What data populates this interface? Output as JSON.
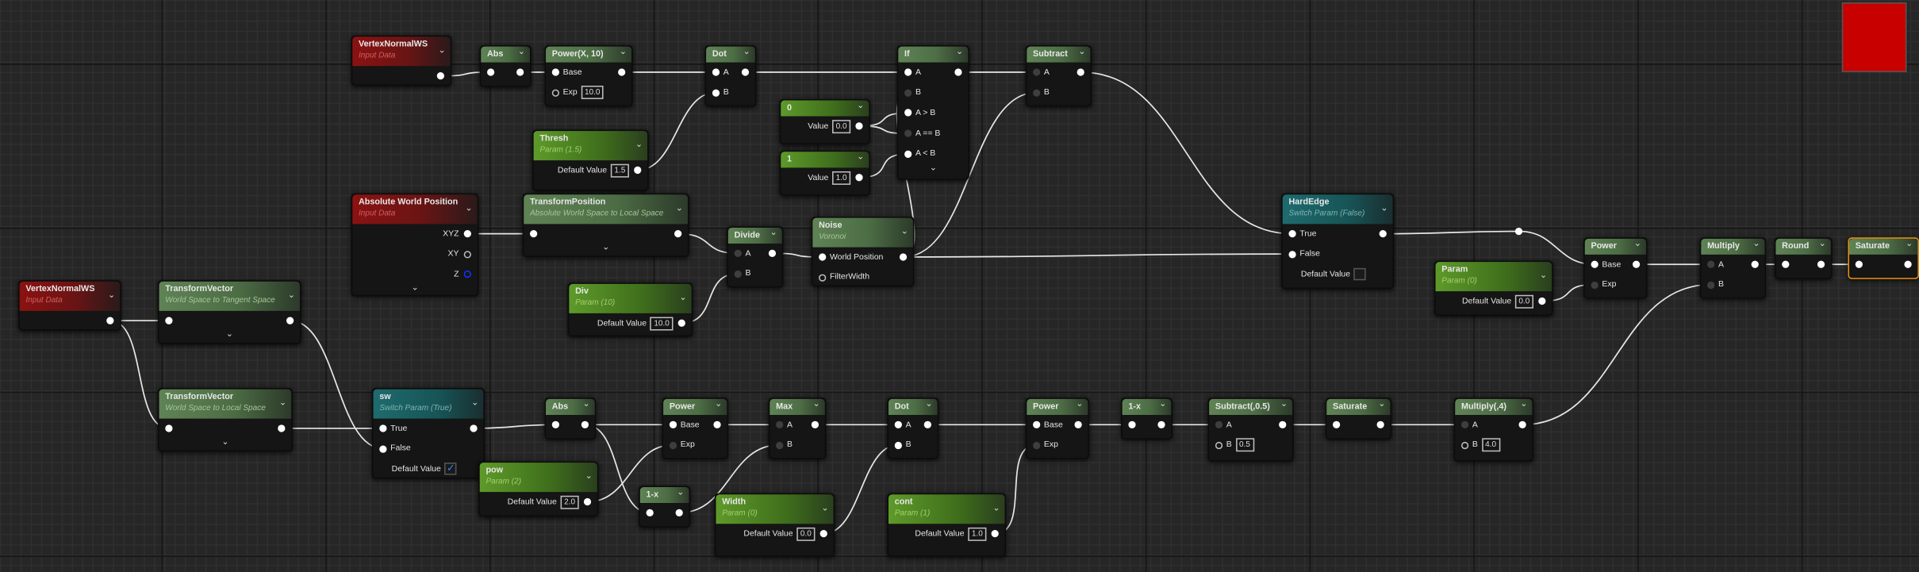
{
  "graph": {
    "nodes": [
      {
        "id": "vnws1",
        "kind": "input",
        "title": "VertexNormalWS",
        "subtitle": "Input Data",
        "rows": [
          {
            "out": "f"
          }
        ]
      },
      {
        "id": "abs1",
        "kind": "function",
        "title": "Abs",
        "rows": [
          {
            "in": "f",
            "out": "f"
          }
        ]
      },
      {
        "id": "pow10",
        "kind": "function",
        "title": "Power(X, 10)",
        "rows": [
          {
            "label": "Base",
            "in": "f",
            "out": "f"
          },
          {
            "label": "Exp",
            "value": "10.0",
            "in": "h"
          }
        ]
      },
      {
        "id": "dot1",
        "kind": "function",
        "title": "Dot",
        "rows": [
          {
            "label": "A",
            "in": "f",
            "out": "f"
          },
          {
            "label": "B",
            "in": "f"
          }
        ]
      },
      {
        "id": "thresh",
        "kind": "param",
        "title": "Thresh",
        "subtitle": "Param (1.5)",
        "rows": [
          {
            "label": "Default Value",
            "value": "1.5",
            "out": "f"
          }
        ]
      },
      {
        "id": "c0",
        "kind": "param",
        "title": "0",
        "rows": [
          {
            "label": "Value",
            "value": "0.0",
            "out": "f"
          }
        ]
      },
      {
        "id": "c1",
        "kind": "param",
        "title": "1",
        "rows": [
          {
            "label": "Value",
            "value": "1.0",
            "out": "f"
          }
        ]
      },
      {
        "id": "if",
        "kind": "function",
        "title": "If",
        "expand": true,
        "rows": [
          {
            "label": "A",
            "in": "f",
            "out": "f"
          },
          {
            "label": "B",
            "in": "d"
          },
          {
            "label": "A > B",
            "in": "f"
          },
          {
            "label": "A == B",
            "in": "d"
          },
          {
            "label": "A < B",
            "in": "f"
          }
        ]
      },
      {
        "id": "subtract",
        "kind": "function",
        "title": "Subtract",
        "rows": [
          {
            "label": "A",
            "in": "d",
            "out": "f"
          },
          {
            "label": "B",
            "in": "d"
          }
        ]
      },
      {
        "id": "awp",
        "kind": "input",
        "title": "Absolute World Position",
        "subtitle": "Input Data",
        "expand": true,
        "rows": [
          {
            "label": "XYZ",
            "out": "f"
          },
          {
            "label": "XY",
            "out": "h"
          },
          {
            "label": "Z",
            "out": "blue"
          }
        ]
      },
      {
        "id": "tpos",
        "kind": "function",
        "title": "TransformPosition",
        "subtitle": "Absolute World Space to Local Space",
        "expand": true,
        "rows": [
          {
            "in": "f",
            "out": "f"
          }
        ]
      },
      {
        "id": "divide",
        "kind": "function",
        "title": "Divide",
        "rows": [
          {
            "label": "A",
            "in": "d",
            "out": "f"
          },
          {
            "label": "B",
            "in": "d"
          }
        ]
      },
      {
        "id": "div",
        "kind": "param",
        "title": "Div",
        "subtitle": "Param (10)",
        "rows": [
          {
            "label": "Default Value",
            "value": "10.0",
            "out": "f"
          }
        ]
      },
      {
        "id": "noise",
        "kind": "function",
        "title": "Noise",
        "subtitle": "Voronoi",
        "rows": [
          {
            "label": "World Position",
            "in": "f",
            "out": "f"
          },
          {
            "label": "FilterWidth",
            "in": "h"
          }
        ]
      },
      {
        "id": "hardedge",
        "kind": "switch",
        "title": "HardEdge",
        "subtitle": "Switch Param (False)",
        "rows": [
          {
            "label": "True",
            "in": "f",
            "out": "f"
          },
          {
            "label": "False",
            "in": "f"
          },
          {
            "label": "Default Value",
            "checked": false
          }
        ]
      },
      {
        "id": "param0",
        "kind": "param",
        "title": "Param",
        "subtitle": "Param (0)",
        "rows": [
          {
            "label": "Default Value",
            "value": "0.0",
            "out": "f"
          }
        ]
      },
      {
        "id": "power2",
        "kind": "function",
        "title": "Power",
        "rows": [
          {
            "label": "Base",
            "in": "f",
            "out": "f"
          },
          {
            "label": "Exp",
            "in": "d"
          }
        ]
      },
      {
        "id": "multiply",
        "kind": "function",
        "title": "Multiply",
        "rows": [
          {
            "label": "A",
            "in": "d",
            "out": "f"
          },
          {
            "label": "B",
            "in": "d"
          }
        ]
      },
      {
        "id": "round",
        "kind": "function",
        "title": "Round",
        "rows": [
          {
            "in": "f",
            "out": "f"
          }
        ]
      },
      {
        "id": "saturate",
        "kind": "function",
        "title": "Saturate",
        "selected": true,
        "rows": [
          {
            "in": "f",
            "out": "f"
          }
        ]
      },
      {
        "id": "vnws2",
        "kind": "input",
        "title": "VertexNormalWS",
        "subtitle": "Input Data",
        "rows": [
          {
            "out": "f"
          }
        ]
      },
      {
        "id": "tv1",
        "kind": "function",
        "title": "TransformVector",
        "subtitle": "World Space to Tangent Space",
        "expand": true,
        "rows": [
          {
            "in": "f",
            "out": "f"
          }
        ]
      },
      {
        "id": "tv2",
        "kind": "function",
        "title": "TransformVector",
        "subtitle": "World Space to Local Space",
        "expand": true,
        "rows": [
          {
            "in": "f",
            "out": "f"
          }
        ]
      },
      {
        "id": "sw",
        "kind": "switch",
        "title": "sw",
        "subtitle": "Switch Param (True)",
        "rows": [
          {
            "label": "True",
            "in": "f",
            "out": "f"
          },
          {
            "label": "False",
            "in": "f"
          },
          {
            "label": "Default Value",
            "checked": true
          }
        ]
      },
      {
        "id": "abs2",
        "kind": "function",
        "title": "Abs",
        "rows": [
          {
            "in": "f",
            "out": "f"
          }
        ]
      },
      {
        "id": "pow",
        "kind": "param",
        "title": "pow",
        "subtitle": "Param (2)",
        "rows": [
          {
            "label": "Default Value",
            "value": "2.0",
            "out": "f"
          }
        ]
      },
      {
        "id": "power3",
        "kind": "function",
        "title": "Power",
        "rows": [
          {
            "label": "Base",
            "in": "f",
            "out": "f"
          },
          {
            "label": "Exp",
            "in": "d"
          }
        ]
      },
      {
        "id": "onex1",
        "kind": "function",
        "title": "1-x",
        "rows": [
          {
            "in": "f",
            "out": "f"
          }
        ]
      },
      {
        "id": "max",
        "kind": "function",
        "title": "Max",
        "rows": [
          {
            "label": "A",
            "in": "d",
            "out": "f"
          },
          {
            "label": "B",
            "in": "d"
          }
        ]
      },
      {
        "id": "width",
        "kind": "param",
        "title": "Width",
        "subtitle": "Param (0)",
        "rows": [
          {
            "label": "Default Value",
            "value": "0.0",
            "out": "f"
          }
        ]
      },
      {
        "id": "dot2",
        "kind": "function",
        "title": "Dot",
        "rows": [
          {
            "label": "A",
            "in": "f",
            "out": "f"
          },
          {
            "label": "B",
            "in": "f"
          }
        ]
      },
      {
        "id": "cont",
        "kind": "param",
        "title": "cont",
        "subtitle": "Param (1)",
        "rows": [
          {
            "label": "Default Value",
            "value": "1.0",
            "out": "f"
          }
        ]
      },
      {
        "id": "power4",
        "kind": "function",
        "title": "Power",
        "rows": [
          {
            "label": "Base",
            "in": "f",
            "out": "f"
          },
          {
            "label": "Exp",
            "in": "d"
          }
        ]
      },
      {
        "id": "onex2",
        "kind": "function",
        "title": "1-x",
        "rows": [
          {
            "in": "f",
            "out": "f"
          }
        ]
      },
      {
        "id": "sub05",
        "kind": "function",
        "title": "Subtract(,0.5)",
        "rows": [
          {
            "label": "A",
            "in": "d",
            "out": "f"
          },
          {
            "label": "B",
            "value": "0.5",
            "in": "h"
          }
        ]
      },
      {
        "id": "sat2",
        "kind": "function",
        "title": "Saturate",
        "rows": [
          {
            "in": "f",
            "out": "f"
          }
        ]
      },
      {
        "id": "mul4",
        "kind": "function",
        "title": "Multiply(,4)",
        "rows": [
          {
            "label": "A",
            "in": "d",
            "out": "f"
          },
          {
            "label": "B",
            "value": "4.0",
            "in": "h"
          }
        ]
      }
    ],
    "preview_color": "#c80000",
    "selection_color": "#e8920c",
    "expand_icon": "chevron-down-icon"
  }
}
